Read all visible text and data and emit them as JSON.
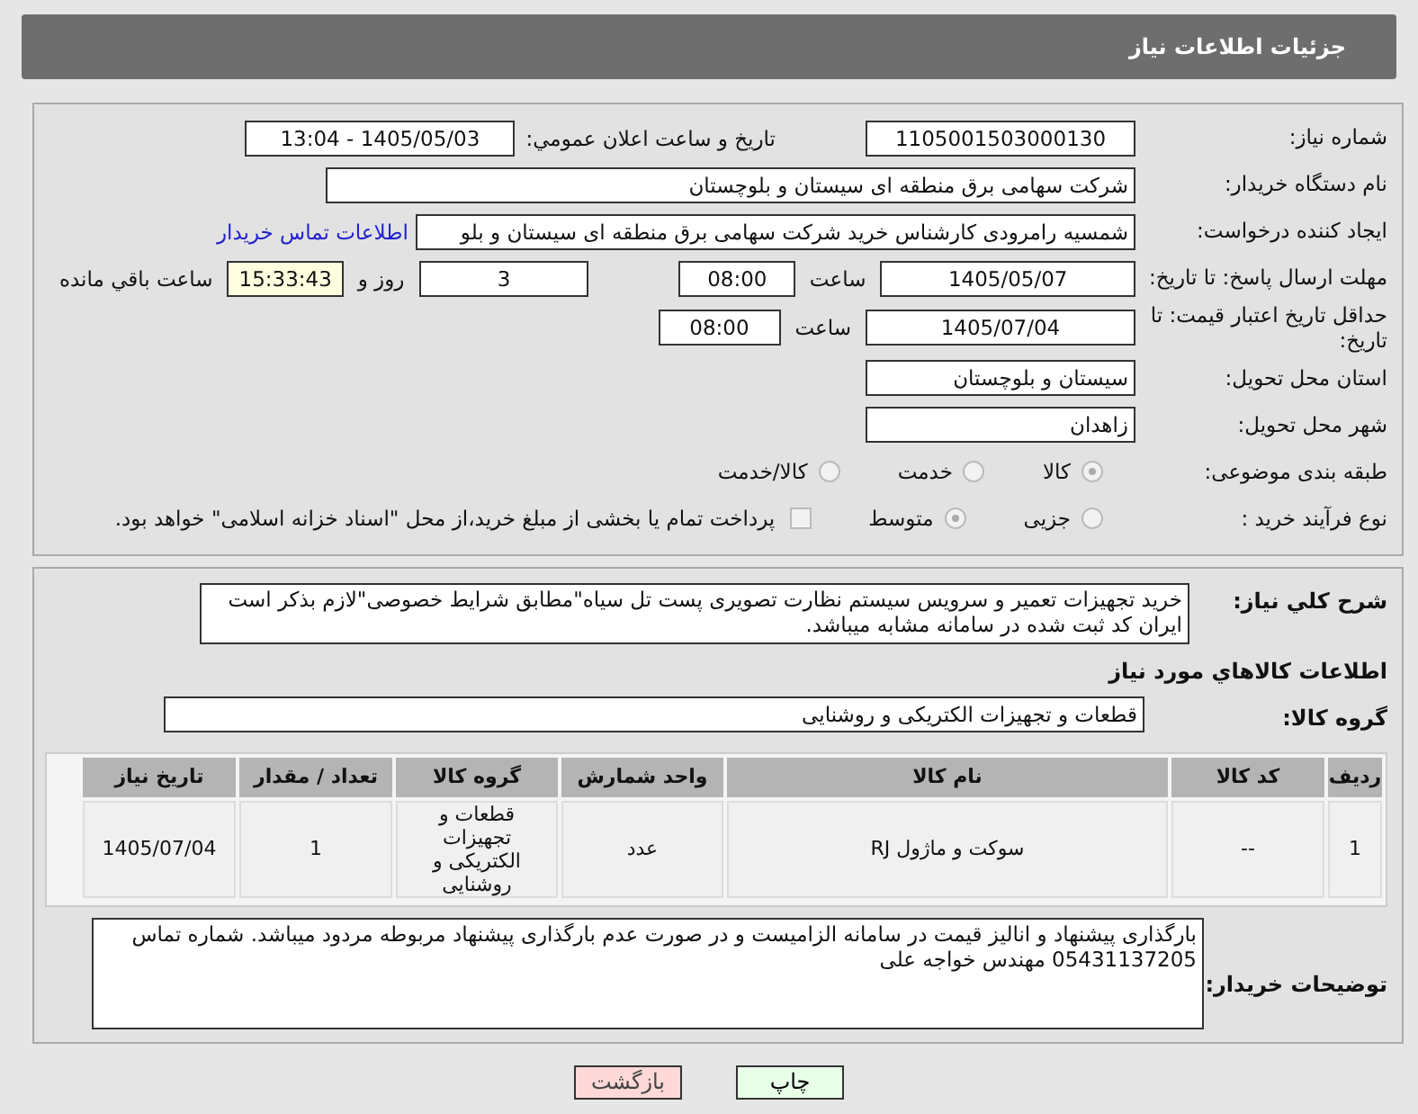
{
  "header": {
    "title": "جزئیات اطلاعات نیاز"
  },
  "need_number": {
    "label": "شماره نیاز:",
    "value": "1105001503000130"
  },
  "announce": {
    "label": "تاريخ و ساعت اعلان عمومي:",
    "value": "1405/05/03 - 13:04"
  },
  "buyer_org": {
    "label": "نام دستگاه خریدار:",
    "value": "شرکت سهامی برق منطقه ای سیستان و بلوچستان"
  },
  "creator": {
    "label": "ایجاد کننده درخواست:",
    "value": "شمسیه رامرودی کارشناس خرید شرکت سهامی برق منطقه ای سیستان و بلو",
    "link": "اطلاعات تماس خریدار"
  },
  "deadline": {
    "label": "مهلت ارسال پاسخ: تا تاریخ:",
    "date": "1405/05/07",
    "time_label": "ساعت",
    "time": "08:00",
    "days": "3",
    "days_label": "روز و",
    "remaining": "15:33:43",
    "remaining_label": "ساعت باقي مانده"
  },
  "validity": {
    "label": "حداقل تاریخ اعتبار قیمت: تا تاریخ:",
    "date": "1405/07/04",
    "time_label": "ساعت",
    "time": "08:00"
  },
  "province": {
    "label": "استان محل تحویل:",
    "value": "سیستان و بلوچستان"
  },
  "city": {
    "label": "شهر محل تحویل:",
    "value": "زاهدان"
  },
  "category": {
    "label": "طبقه بندی موضوعی:",
    "options": [
      {
        "label": "کالا",
        "selected": true
      },
      {
        "label": "خدمت",
        "selected": false
      },
      {
        "label": "کالا/خدمت",
        "selected": false
      }
    ]
  },
  "process": {
    "label": "نوع فرآیند خرید :",
    "options": [
      {
        "label": "جزیی",
        "selected": false
      },
      {
        "label": "متوسط",
        "selected": true
      }
    ],
    "treasury": {
      "label": "پرداخت تمام یا بخشی از مبلغ خرید،از محل \"اسناد خزانه اسلامی\" خواهد بود.",
      "checked": false
    }
  },
  "description": {
    "label": "شرح کلي نیاز:",
    "value": "خرید تجهیزات تعمیر و سرویس سیستم نظارت تصویری پست تل سیاه\"مطابق شرایط خصوصی\"لازم بذکر است ایران کد ثبت شده در سامانه مشابه میباشد."
  },
  "goods_title": "اطلاعات کالاهاي مورد نیاز",
  "goods_group": {
    "label": "گروه کالا:",
    "value": "قطعات و تجهیزات الکتریکی و روشنایی"
  },
  "table": {
    "columns": [
      "ردیف",
      "کد کالا",
      "نام کالا",
      "واحد شمارش",
      "گروه کالا",
      "تعداد / مقدار",
      "تاریخ نیاز"
    ],
    "rows": [
      [
        "1",
        "--",
        "سوکت و ماژول RJ",
        "عدد",
        "قطعات و تجهیزات الکتریکی و روشنایی",
        "1",
        "1405/07/04"
      ]
    ]
  },
  "buyer_notes": {
    "label": "توضیحات خریدار:",
    "value": "بارگذاری پیشنهاد و انالیز قیمت در سامانه الزامیست و در صورت عدم بارگذاری پیشنهاد مربوطه مردود میباشد. شماره تماس 05431137205 مهندس خواجه علی"
  },
  "buttons": [
    {
      "label": "چاپ",
      "kind": "print"
    },
    {
      "label": "بازگشت",
      "kind": "back"
    }
  ]
}
